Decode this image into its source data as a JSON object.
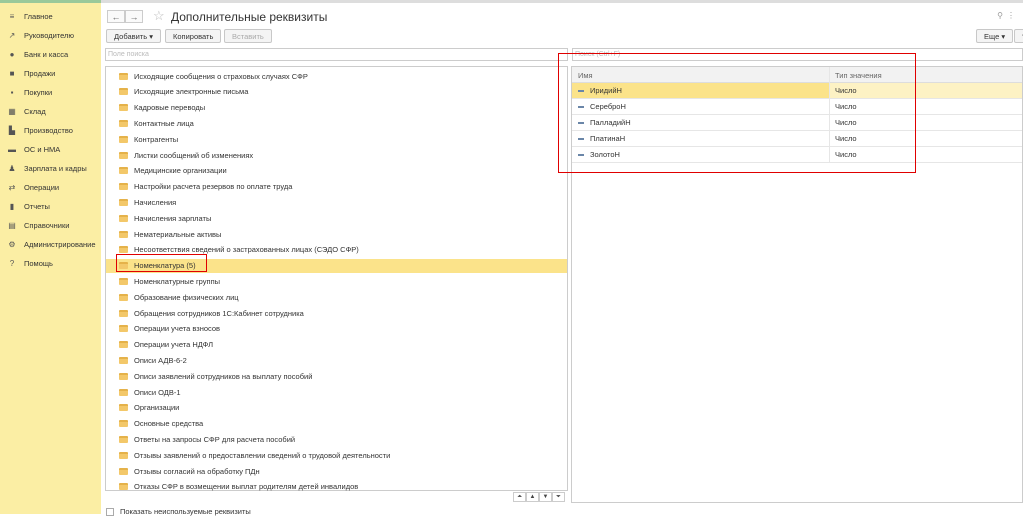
{
  "sidebar": {
    "items": [
      {
        "label": "Главное",
        "icon": "menu-icon",
        "glyph": "≡"
      },
      {
        "label": "Руководителю",
        "icon": "trend-icon",
        "glyph": "↗"
      },
      {
        "label": "Банк и касса",
        "icon": "bank-icon",
        "glyph": "●"
      },
      {
        "label": "Продажи",
        "icon": "bag-icon",
        "glyph": "■"
      },
      {
        "label": "Покупки",
        "icon": "cart-icon",
        "glyph": "▪"
      },
      {
        "label": "Склад",
        "icon": "warehouse-icon",
        "glyph": "▦"
      },
      {
        "label": "Производство",
        "icon": "factory-icon",
        "glyph": "▙"
      },
      {
        "label": "ОС и НМА",
        "icon": "assets-icon",
        "glyph": "▬"
      },
      {
        "label": "Зарплата и кадры",
        "icon": "people-icon",
        "glyph": "♟"
      },
      {
        "label": "Операции",
        "icon": "operations-icon",
        "glyph": "⇄"
      },
      {
        "label": "Отчеты",
        "icon": "reports-icon",
        "glyph": "▮"
      },
      {
        "label": "Справочники",
        "icon": "books-icon",
        "glyph": "▤"
      },
      {
        "label": "Администрирование",
        "icon": "gear-icon",
        "glyph": "⚙"
      },
      {
        "label": "Помощь",
        "icon": "help-icon",
        "glyph": "?"
      }
    ]
  },
  "header": {
    "title": "Дополнительные реквизиты",
    "back": "←",
    "forward": "→",
    "star": "☆",
    "link": "🔗",
    "more": "⋮"
  },
  "toolbar": {
    "add": "Добавить ▾",
    "copy": "Копировать",
    "paste": "Вставить",
    "more": "Еще ▾",
    "help": "?"
  },
  "left": {
    "search_placeholder": "Поле поиска",
    "items": [
      "Исходящие сообщения о страховых случаях СФР",
      "Исходящие электронные письма",
      "Кадровые переводы",
      "Контактные лица",
      "Контрагенты",
      "Листки сообщений об изменениях",
      "Медицинские организации",
      "Настройки расчета резервов по оплате труда",
      "Начисления",
      "Начисления зарплаты",
      "Нематериальные активы",
      "Несоответствия сведений о застрахованных лицах (СЭДО СФР)",
      "Номенклатура (5)",
      "Номенклатурные группы",
      "Образование физических лиц",
      "Обращения сотрудников 1С:Кабинет сотрудника",
      "Операции учета взносов",
      "Операции учета НДФЛ",
      "Описи АДВ-6-2",
      "Описи заявлений сотрудников на выплату пособий",
      "Описи ОДВ-1",
      "Организации",
      "Основные средства",
      "Ответы на запросы СФР для расчета пособий",
      "Отзывы заявлений о предоставлении сведений о трудовой деятельности",
      "Отзывы согласий на обработку ПДн",
      "Отказы СФР в возмещении выплат родителям детей инвалидов"
    ],
    "pager": [
      "⏶",
      "▲",
      "▼",
      "⏷"
    ],
    "show_unused": "Показать неиспользуемые реквизиты"
  },
  "right": {
    "search_placeholder": "Поиск (Ctrl+F)",
    "columns": [
      "Имя",
      "Тип значения"
    ],
    "rows": [
      {
        "name": "ИридийН",
        "type": "Число"
      },
      {
        "name": "СереброН",
        "type": "Число"
      },
      {
        "name": "ПалладийН",
        "type": "Число"
      },
      {
        "name": "ПлатинаН",
        "type": "Число"
      },
      {
        "name": "ЗолотоН",
        "type": "Число"
      }
    ]
  },
  "colors": {
    "sidebar": "#fbeea4",
    "selected": "#fbe38a",
    "highlight": "#e00000"
  }
}
